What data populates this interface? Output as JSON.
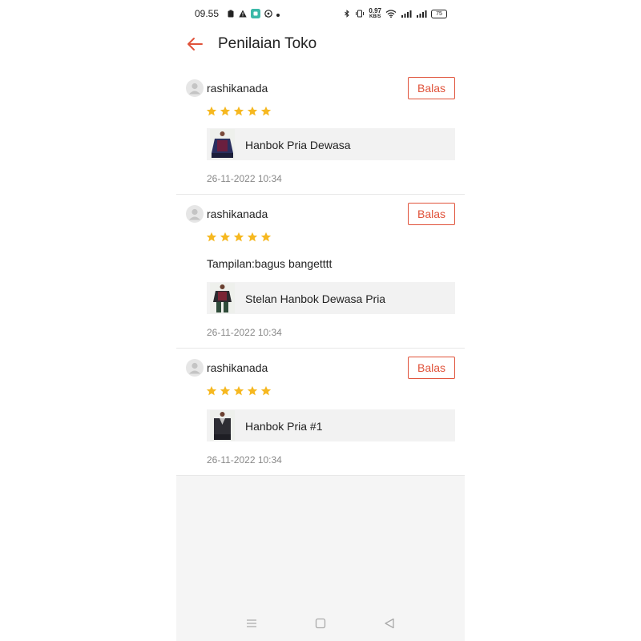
{
  "status_bar": {
    "time": "09.55",
    "network_speed_value": "0.97",
    "network_speed_unit": "KB/S",
    "battery": "75",
    "left_icons": [
      "clipboard-icon",
      "warning-icon",
      "app-notification-icon",
      "whatsapp-icon",
      "more-dot-icon"
    ],
    "right_icons": [
      "bluetooth-icon",
      "vibrate-icon",
      "network-speed",
      "wifi-icon",
      "signal-icon",
      "signal-icon",
      "battery-icon"
    ]
  },
  "header": {
    "title": "Penilaian Toko",
    "back_icon": "arrow-left-icon"
  },
  "colors": {
    "accent": "#e0523a",
    "star": "#f6b820",
    "background": "#f5f5f5"
  },
  "reviews": [
    {
      "username": "rashikanada",
      "rating": 5,
      "reply_label": "Balas",
      "comment": "",
      "product_name": "Hanbok Pria Dewasa",
      "timestamp": "26-11-2022 10:34"
    },
    {
      "username": "rashikanada",
      "rating": 5,
      "reply_label": "Balas",
      "comment": "Tampilan:bagus bangetttt",
      "product_name": "Stelan Hanbok Dewasa Pria",
      "timestamp": "26-11-2022 10:34"
    },
    {
      "username": "rashikanada",
      "rating": 5,
      "reply_label": "Balas",
      "comment": "",
      "product_name": "Hanbok Pria #1",
      "timestamp": "26-11-2022 10:34"
    }
  ],
  "nav_bar": {
    "buttons": [
      "menu-icon",
      "home-icon",
      "back-triangle-icon"
    ]
  }
}
